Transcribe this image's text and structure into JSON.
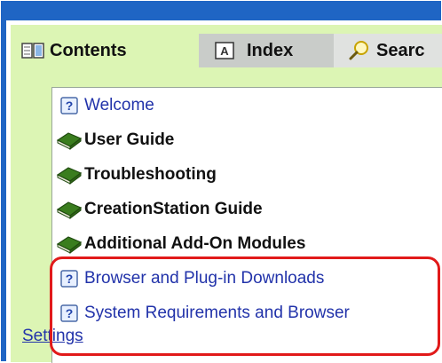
{
  "tabs": [
    {
      "label": "Contents",
      "icon": "book-open-icon"
    },
    {
      "label": "Index",
      "icon": "index-a-icon"
    },
    {
      "label": "Searc",
      "icon": "magnifier-icon"
    }
  ],
  "toc": {
    "items": [
      {
        "label": "Welcome",
        "icon": "help-page-icon",
        "kind": "link"
      },
      {
        "label": "User Guide",
        "icon": "closed-book-icon",
        "kind": "book"
      },
      {
        "label": "Troubleshooting",
        "icon": "closed-book-icon",
        "kind": "book"
      },
      {
        "label": "CreationStation Guide",
        "icon": "closed-book-icon",
        "kind": "book"
      },
      {
        "label": "Additional Add-On Modules",
        "icon": "closed-book-icon",
        "kind": "book"
      },
      {
        "label": "Browser and Plug-in Downloads",
        "icon": "help-page-icon",
        "kind": "link"
      },
      {
        "label": "System Requirements and Browser",
        "icon": "help-page-icon",
        "kind": "link"
      },
      {
        "label": "Settings",
        "icon": "",
        "kind": "link-continuation"
      }
    ]
  },
  "colors": {
    "frame_blue": "#1f65c4",
    "panel_green": "#dcf5b4",
    "highlight_red": "#e11a1a",
    "link_blue": "#2233aa"
  }
}
